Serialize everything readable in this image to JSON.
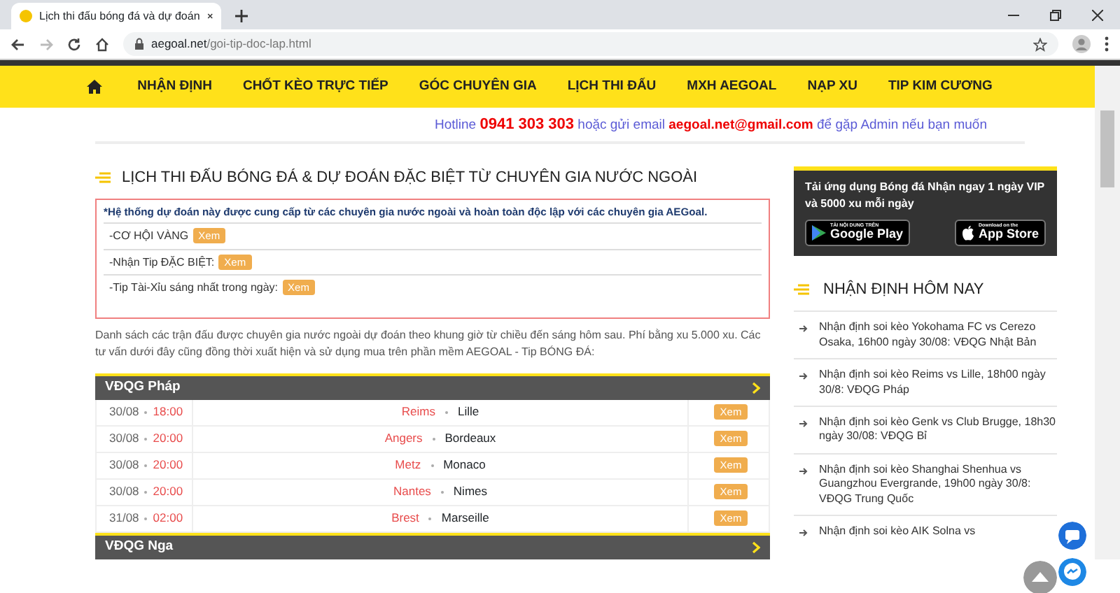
{
  "browser": {
    "tab_title": "Lịch thi đấu bóng đá và dự đoán",
    "url_domain": "aegoal.net",
    "url_path": "/goi-tip-doc-lap.html"
  },
  "nav": {
    "items": [
      "NHẬN ĐỊNH",
      "CHỐT KÈO TRỰC TIẾP",
      "GÓC CHUYÊN GIA",
      "LỊCH THI ĐẤU",
      "MXH AEGOAL",
      "NẠP XU",
      "TIP KIM CƯƠNG"
    ]
  },
  "contact": {
    "label": "Hotline",
    "phone": "0941 303 303",
    "middle": "hoặc gửi email",
    "email": "aegoal.net@gmail.com",
    "end": "để gặp Admin nếu bạn muốn"
  },
  "main": {
    "title": "LỊCH THI ĐẤU BÓNG ĐÁ & DỰ ĐOÁN ĐẶC BIỆT TỪ CHUYÊN GIA NƯỚC NGOÀI",
    "notice": {
      "intro": "*Hệ thống dự đoán này được cung cấp từ các chuyên gia nước ngoài và hoàn toàn độc lập với các chuyên gia AEGoal.",
      "items": [
        {
          "label": "-CƠ HỘI VÀNG",
          "button": "Xem"
        },
        {
          "label": "-Nhận Tip ĐẶC BIỆT:",
          "button": "Xem"
        },
        {
          "label": "-Tip Tài-Xỉu sáng nhất trong ngày:",
          "button": "Xem"
        }
      ]
    },
    "description": "Danh sách các trận đấu được chuyên gia nước ngoài dự đoán theo khung giờ từ chiều đến sáng hôm sau. Phí bằng xu 5.000 xu. Các tư vấn dưới đây cũng đồng thời xuất hiện và sử dụng mua trên phần mềm AEGOAL - Tip BÓNG ĐÁ:",
    "leagues": [
      {
        "name": "VĐQG Pháp",
        "matches": [
          {
            "date": "30/08",
            "time": "18:00",
            "home": "Reims",
            "away": "Lille",
            "button": "Xem"
          },
          {
            "date": "30/08",
            "time": "20:00",
            "home": "Angers",
            "away": "Bordeaux",
            "button": "Xem"
          },
          {
            "date": "30/08",
            "time": "20:00",
            "home": "Metz",
            "away": "Monaco",
            "button": "Xem"
          },
          {
            "date": "30/08",
            "time": "20:00",
            "home": "Nantes",
            "away": "Nimes",
            "button": "Xem"
          },
          {
            "date": "31/08",
            "time": "02:00",
            "home": "Brest",
            "away": "Marseille",
            "button": "Xem"
          }
        ]
      },
      {
        "name": "VĐQG Nga"
      }
    ]
  },
  "sidebar": {
    "app_promo": {
      "text": "Tải ứng dụng Bóng đá Nhận ngay 1 ngày VIP và 5000 xu mỗi ngày",
      "stores": [
        {
          "kind": "google",
          "caption": "TẢI NỘI DUNG TRÊN",
          "label": "Google Play"
        },
        {
          "kind": "apple",
          "caption": "Download on the",
          "label": "App Store"
        }
      ]
    },
    "heading": "NHẬN ĐỊNH HÔM NAY",
    "articles": [
      "Nhận định soi kèo Yokohama FC vs Cerezo Osaka, 16h00 ngày 30/08: VĐQG Nhật Bản",
      "Nhận định soi kèo Reims vs Lille, 18h00 ngày 30/8: VĐQG Pháp",
      "Nhận định soi kèo Genk vs Club Brugge, 18h30 ngày 30/08: VĐQG Bỉ",
      "Nhận định soi kèo Shanghai Shenhua vs Guangzhou Evergrande, 19h00 ngày 30/8: VĐQG Trung Quốc",
      "Nhận định soi kèo AIK Solna vs"
    ]
  }
}
